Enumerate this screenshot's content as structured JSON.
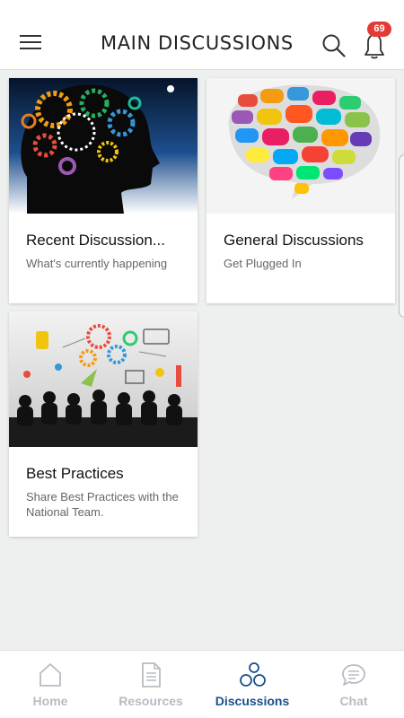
{
  "header": {
    "title": "MAIN DISCUSSIONS",
    "notification_count": "69"
  },
  "cards": [
    {
      "title": "Recent Discussion...",
      "subtitle": "What's currently happening",
      "image": "head-with-gears-image"
    },
    {
      "title": "General Discussions",
      "subtitle": "Get Plugged In",
      "image": "colorful-speech-bubbles-image"
    },
    {
      "title": "Best Practices",
      "subtitle": "Share Best Practices with the National Team.",
      "image": "meeting-silhouettes-image"
    }
  ],
  "bottom_nav": {
    "items": [
      {
        "label": "Home",
        "icon": "home-icon",
        "active": false
      },
      {
        "label": "Resources",
        "icon": "document-icon",
        "active": false
      },
      {
        "label": "Discussions",
        "icon": "bubbles-icon",
        "active": true
      },
      {
        "label": "Chat",
        "icon": "chat-icon",
        "active": false
      }
    ]
  },
  "colors": {
    "badge": "#e53935",
    "nav_active": "#1a4f8c",
    "nav_inactive": "#b7bcc2",
    "background": "#eef0f0"
  }
}
